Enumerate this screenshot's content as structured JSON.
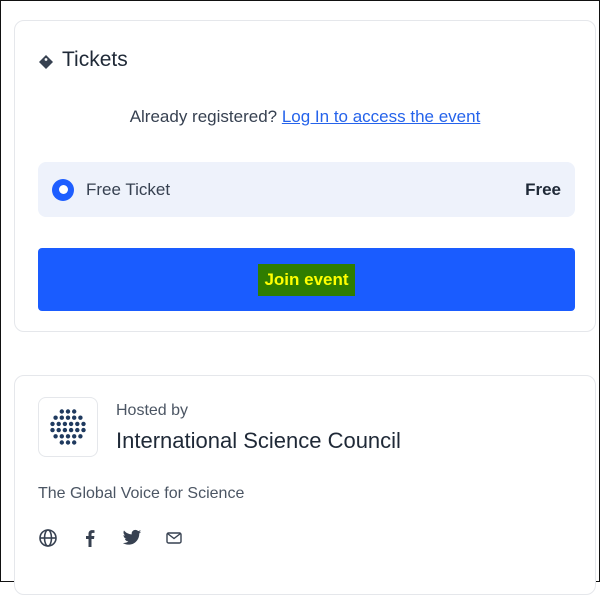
{
  "tickets": {
    "title": "Tickets",
    "registered_prompt": "Already registered?",
    "login_link": "Log In to access the event",
    "option": {
      "name": "Free Ticket",
      "price": "Free",
      "selected": true
    },
    "join_label": "Join event"
  },
  "host": {
    "hosted_by": "Hosted by",
    "name": "International Science Council",
    "tagline": "The Global Voice for Science",
    "social_icons": [
      "globe-icon",
      "facebook-icon",
      "twitter-icon",
      "email-icon"
    ]
  },
  "colors": {
    "accent": "#1a5cff",
    "radio": "#1e5eff",
    "option_bg": "#eef2fb",
    "link": "#2563eb",
    "highlight_bg": "#2f7d00",
    "highlight_text": "#ffff00",
    "logo_dots": "#1f3a5f"
  }
}
